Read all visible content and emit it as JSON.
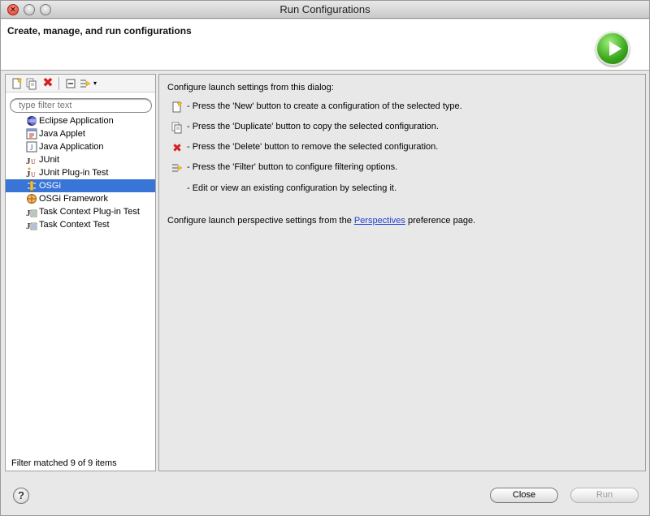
{
  "window": {
    "title": "Run Configurations"
  },
  "header": {
    "title": "Create, manage, and run configurations"
  },
  "toolbar": {
    "new_icon": "new-config-icon",
    "duplicate_icon": "duplicate-icon",
    "delete_icon": "delete-icon",
    "delete_glyph": "✖",
    "collapse_icon": "collapse-all-icon",
    "filter_icon": "filter-icon",
    "dropdown_glyph": "▾"
  },
  "search": {
    "placeholder": "type filter text",
    "value": ""
  },
  "tree": {
    "items": [
      {
        "label": "Eclipse Application",
        "icon": "eclipse-icon",
        "selected": false
      },
      {
        "label": "Java Applet",
        "icon": "java-applet-icon",
        "selected": false
      },
      {
        "label": "Java Application",
        "icon": "java-application-icon",
        "selected": false
      },
      {
        "label": "JUnit",
        "icon": "junit-icon",
        "selected": false
      },
      {
        "label": "JUnit Plug-in Test",
        "icon": "junit-plugin-icon",
        "selected": false
      },
      {
        "label": "OSGi",
        "icon": "osgi-icon",
        "selected": true
      },
      {
        "label": "OSGi Framework",
        "icon": "osgi-framework-icon",
        "selected": false
      },
      {
        "label": "Task Context Plug-in Test",
        "icon": "task-context-plugin-icon",
        "selected": false
      },
      {
        "label": "Task Context Test",
        "icon": "task-context-icon",
        "selected": false
      }
    ]
  },
  "filter_status": "Filter matched 9 of 9 items",
  "main": {
    "intro": "Configure launch settings from this dialog:",
    "rows": [
      {
        "icon": "new-config-icon",
        "text": "- Press the 'New' button to create a configuration of the selected type."
      },
      {
        "icon": "duplicate-icon",
        "text": "- Press the 'Duplicate' button to copy the selected configuration."
      },
      {
        "icon": "delete-icon",
        "text": "- Press the 'Delete' button to remove the selected configuration."
      },
      {
        "icon": "filter-icon",
        "text": "- Press the 'Filter' button to configure filtering options."
      },
      {
        "icon": "",
        "text": "- Edit or view an existing configuration by selecting it."
      }
    ],
    "perspectives_before": "Configure launch perspective settings from the ",
    "perspectives_link": "Perspectives",
    "perspectives_after": " preference page."
  },
  "buttons": {
    "help": "?",
    "close": "Close",
    "run": "Run"
  },
  "colors": {
    "selection": "#3875d7",
    "link": "#1f3fd0",
    "delete": "#d42020",
    "run_badge": "#3aa51c"
  }
}
